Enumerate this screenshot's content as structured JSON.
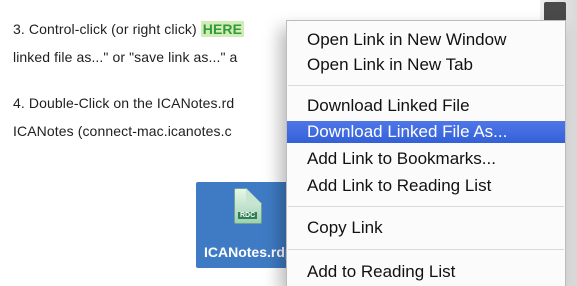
{
  "document": {
    "line1_prefix": "3. Control-click (or right click)",
    "line1_link": "HERE",
    "line2": "linked file as...\" or \"save link as...\" a",
    "line3": "4. Double-Click on the ICANotes.rd",
    "line4": "ICANotes (connect-mac.icanotes.c"
  },
  "desktop_icon": {
    "label": "ICANotes.rdp",
    "tag": "RDC"
  },
  "context_menu": {
    "items": [
      {
        "label": "Open Link in New Window"
      },
      {
        "label": "Open Link in New Tab"
      },
      {
        "label": "Download Linked File"
      },
      {
        "label": "Download Linked File As..."
      },
      {
        "label": "Add Link to Bookmarks..."
      },
      {
        "label": "Add Link to Reading List"
      },
      {
        "label": "Copy Link"
      },
      {
        "label": "Add to Reading List"
      }
    ],
    "highlighted_index": 3,
    "highlight_color": "#3d69de"
  },
  "colors": {
    "link_green": "#2f9c3a",
    "link_bg": "#d2ecb8",
    "icon_selection_blue": "#3f7bc4"
  }
}
